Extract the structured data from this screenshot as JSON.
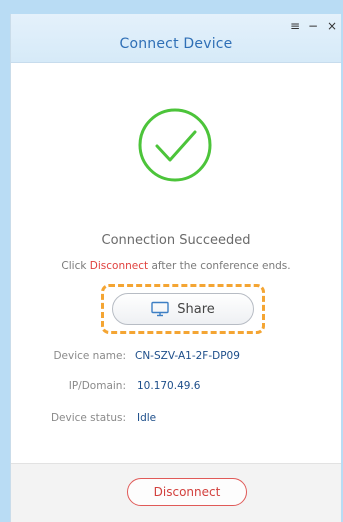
{
  "window": {
    "title": "Connect Device",
    "controls": {
      "menu": "≡",
      "minimize": "−",
      "close": "×"
    }
  },
  "status": {
    "heading": "Connection Succeeded",
    "hint_prefix": "Click",
    "hint_link": "Disconnect",
    "hint_suffix": "after the conference ends."
  },
  "share_button": {
    "label": "Share",
    "icon": "monitor-icon"
  },
  "device_info": {
    "name_label": "Device name:",
    "name_value": "CN-SZV-A1-2F-DP09",
    "ip_label": "IP/Domain:",
    "ip_value": "10.170.49.6",
    "status_label": "Device status:",
    "status_value": "Idle"
  },
  "footer": {
    "disconnect_label": "Disconnect"
  },
  "colors": {
    "accent": "#2f6fb6",
    "success_green": "#4cc43a",
    "danger": "#e0413e",
    "highlight": "#f4a533"
  }
}
